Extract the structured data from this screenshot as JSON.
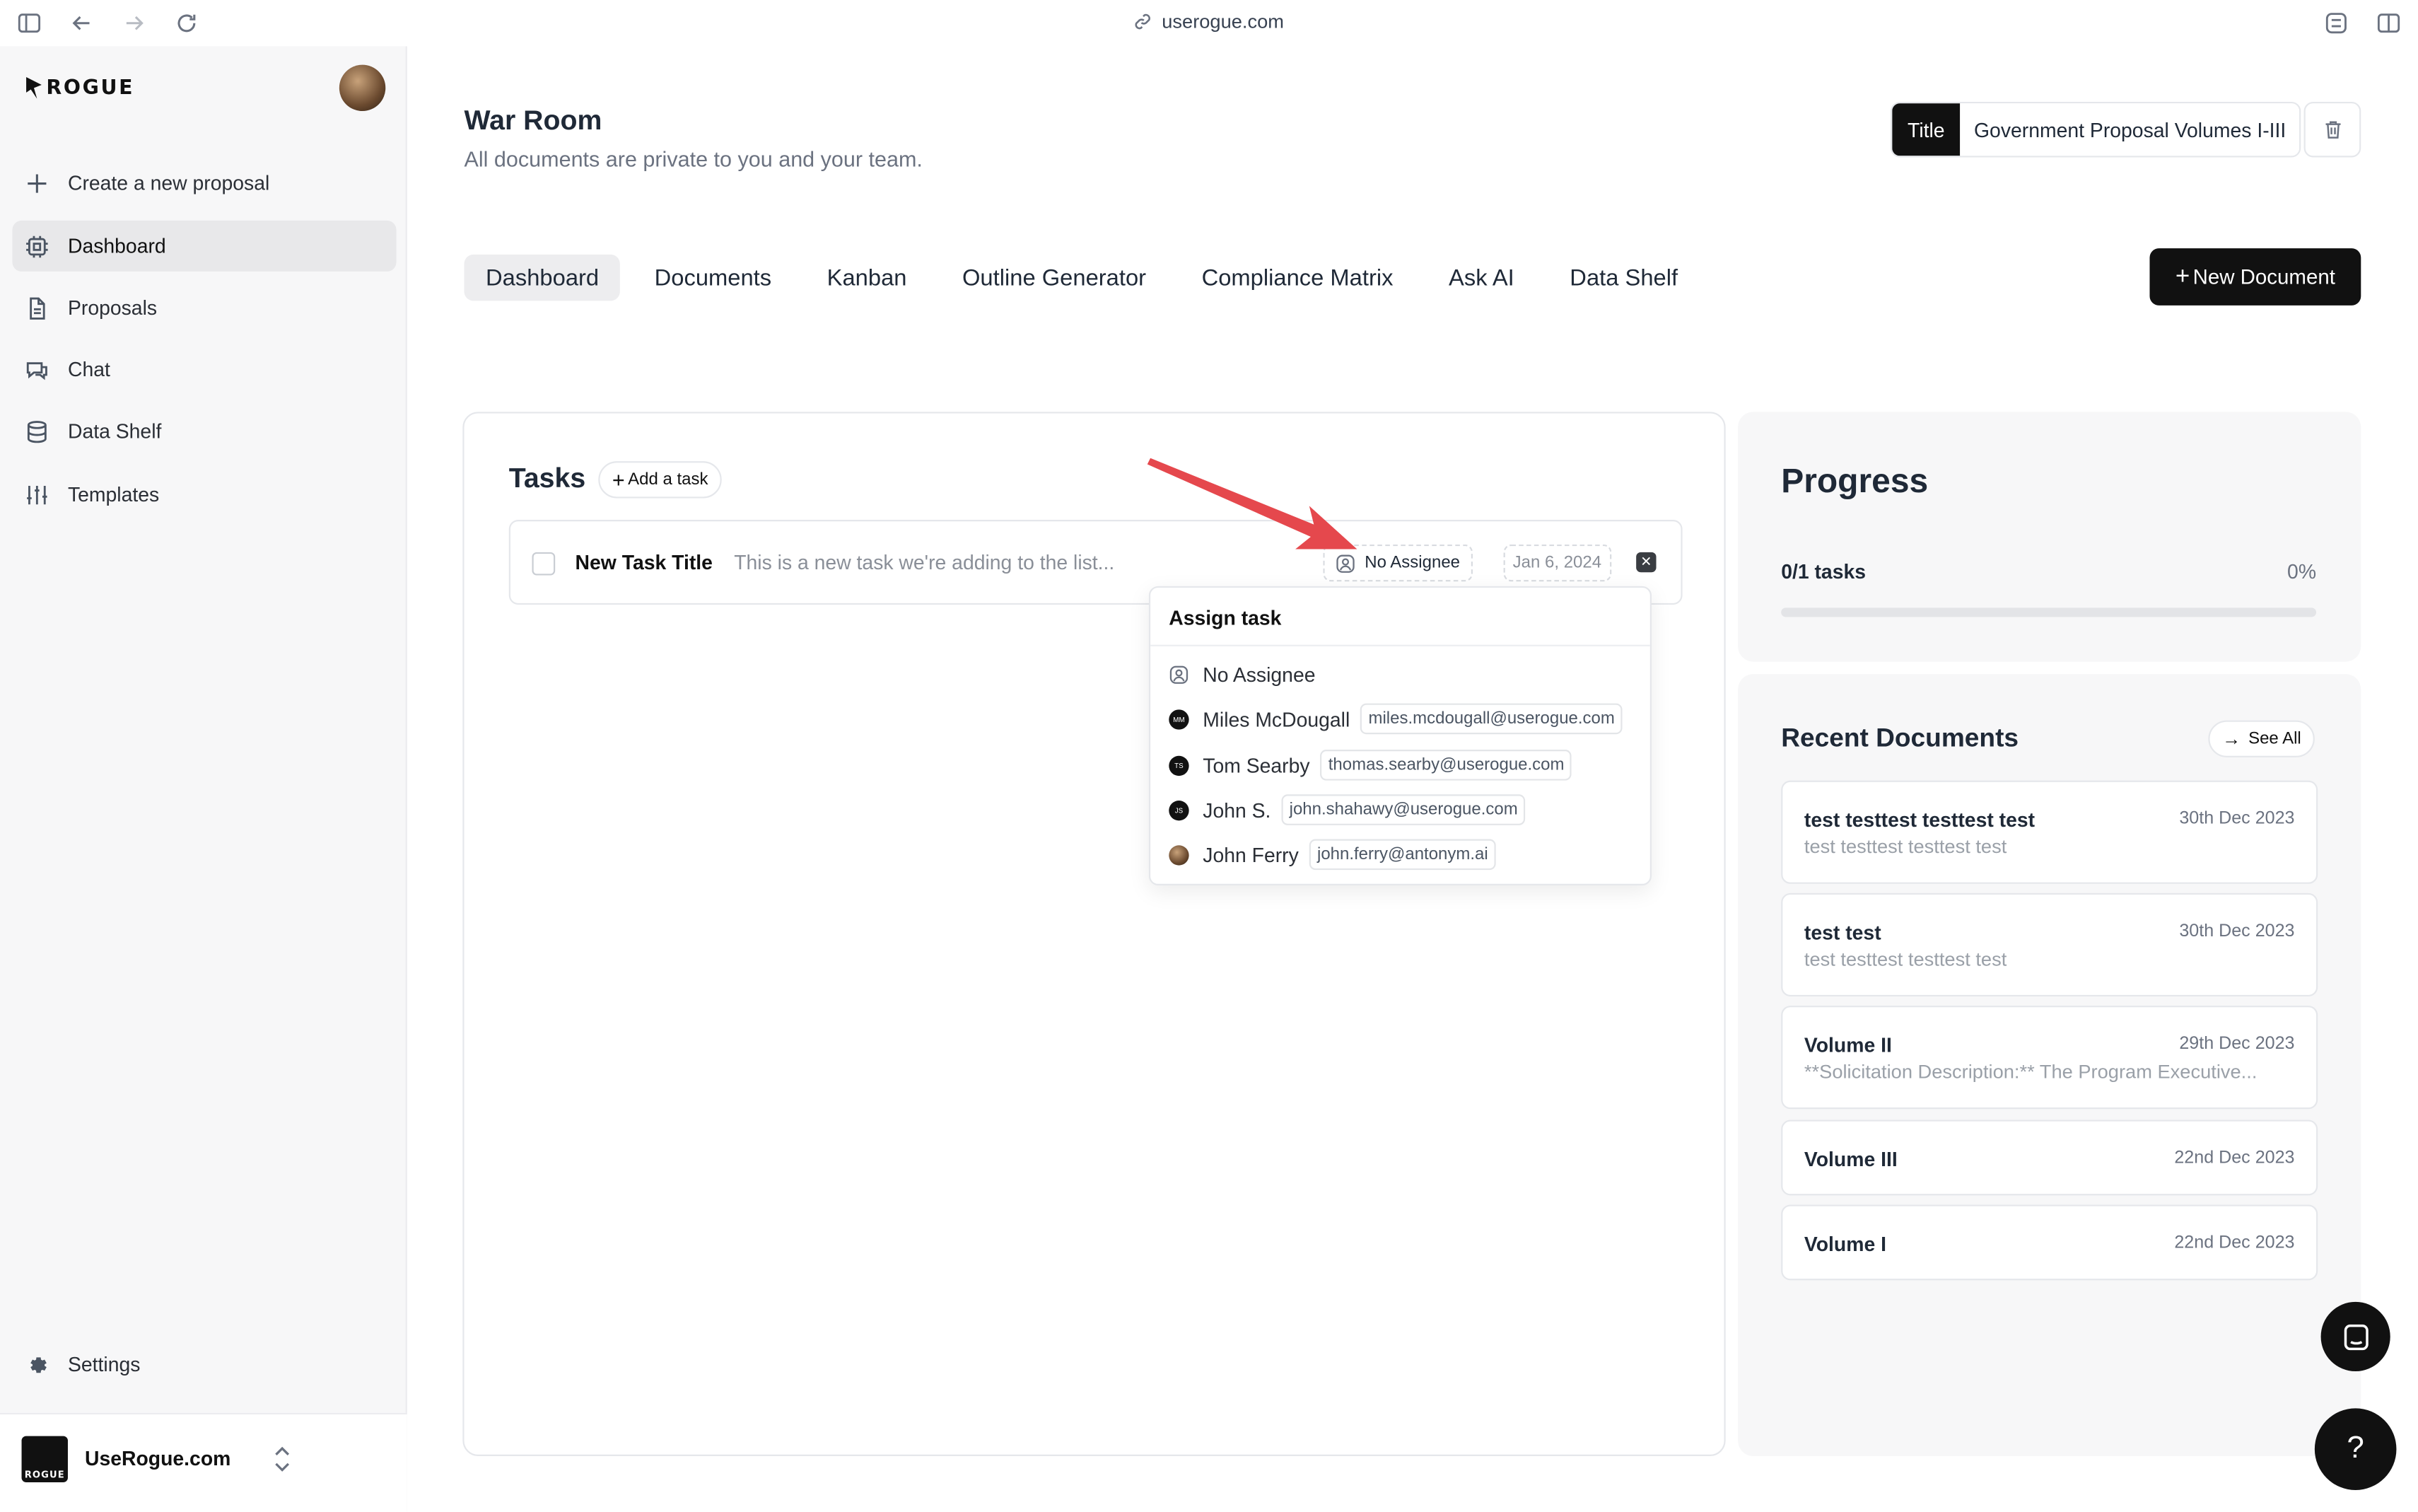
{
  "browser": {
    "url": "userogue.com"
  },
  "brand": {
    "logo_text": "ROGUE"
  },
  "sidebar": {
    "items": [
      {
        "label": "Create a new proposal",
        "icon": "plus-icon"
      },
      {
        "label": "Dashboard",
        "icon": "cpu-icon",
        "active": true
      },
      {
        "label": "Proposals",
        "icon": "document-icon"
      },
      {
        "label": "Chat",
        "icon": "chat-icon"
      },
      {
        "label": "Data Shelf",
        "icon": "database-icon"
      },
      {
        "label": "Templates",
        "icon": "sliders-icon"
      }
    ],
    "settings_label": "Settings",
    "org": {
      "name": "UseRogue.com",
      "logo_text": "ROGUE"
    }
  },
  "header": {
    "title": "War Room",
    "subtitle": "All documents are private to you and your team.",
    "title_tag": "Title",
    "title_value": "Government Proposal Volumes I-III"
  },
  "tabs": [
    "Dashboard",
    "Documents",
    "Kanban",
    "Outline Generator",
    "Compliance Matrix",
    "Ask AI",
    "Data Shelf"
  ],
  "new_document_label": "New Document",
  "tasks": {
    "title": "Tasks",
    "add_label": "Add a task",
    "items": [
      {
        "name": "New Task Title",
        "description": "This is a new task we're adding to the list...",
        "assignee": "No Assignee",
        "date": "Jan 6, 2024"
      }
    ]
  },
  "assign_menu": {
    "title": "Assign task",
    "options": [
      {
        "name": "No Assignee",
        "email": "",
        "initials": ""
      },
      {
        "name": "Miles McDougall",
        "email": "miles.mcdougall@userogue.com",
        "initials": "MM"
      },
      {
        "name": "Tom Searby",
        "email": "thomas.searby@userogue.com",
        "initials": "TS"
      },
      {
        "name": "John S.",
        "email": "john.shahawy@userogue.com",
        "initials": "JS"
      },
      {
        "name": "John Ferry",
        "email": "john.ferry@antonym.ai",
        "initials": ""
      }
    ]
  },
  "progress": {
    "title": "Progress",
    "count_label": "0/1 tasks",
    "percent_label": "0%",
    "fraction": 0
  },
  "recent": {
    "title": "Recent Documents",
    "see_all_label": "See All",
    "docs": [
      {
        "title": "test testtest testtest test",
        "date": "30th Dec 2023",
        "preview": "test testtest testtest test"
      },
      {
        "title": "test test",
        "date": "30th Dec 2023",
        "preview": "test testtest testtest test"
      },
      {
        "title": "Volume II",
        "date": "29th Dec 2023",
        "preview": "**Solicitation Description:** The Program Executive..."
      },
      {
        "title": "Volume III",
        "date": "22nd Dec 2023",
        "preview": ""
      },
      {
        "title": "Volume I",
        "date": "22nd Dec 2023",
        "preview": ""
      }
    ]
  },
  "fab": {
    "help_label": "?"
  },
  "colors": {
    "accent": "#111111",
    "annotation": "#e5484d"
  }
}
